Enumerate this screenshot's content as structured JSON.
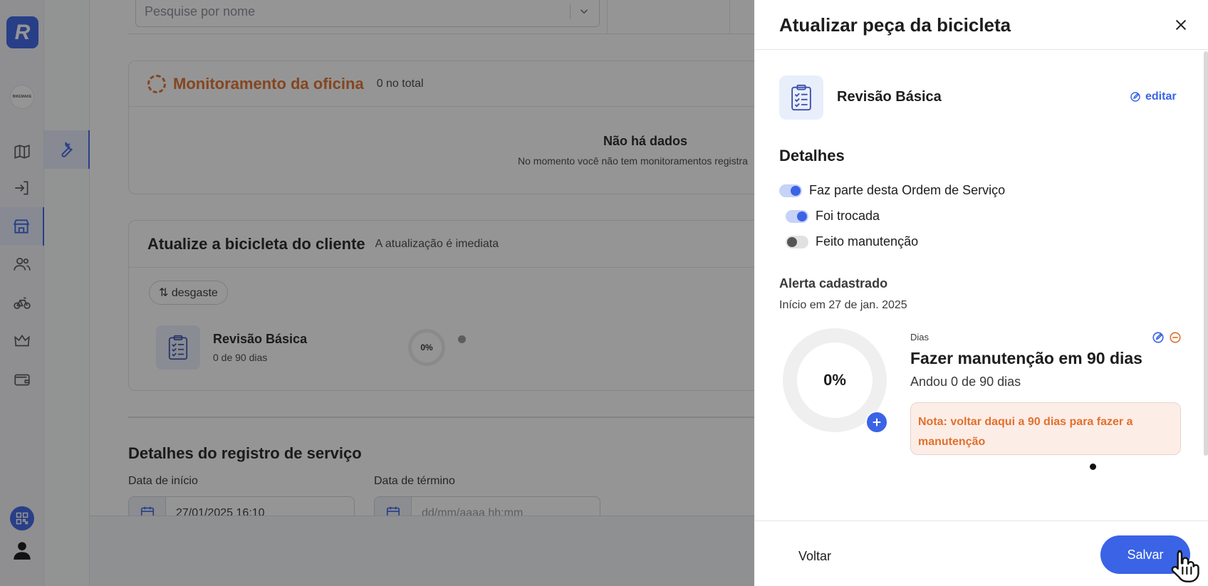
{
  "rail": {
    "logo_letter": "R",
    "brand_text": "BIKEMAKE"
  },
  "main": {
    "search_placeholder": "Pesquise por nome",
    "monitor": {
      "title": "Monitoramento da oficina",
      "count": "0 no total",
      "empty_title": "Não há dados",
      "empty_text": "No momento você não tem monitoramentos registra"
    },
    "bike_update": {
      "title": "Atualize a bicicleta do cliente",
      "subtitle": "A atualização é imediata",
      "sort_chip": "⇅ desgaste",
      "part_name": "Revisão Básica",
      "part_days": "0 de 90 dias",
      "ring_value": "0%"
    },
    "service": {
      "title": "Detalhes do registro de serviço",
      "start_label": "Data de início",
      "end_label": "Data de término",
      "start_value": "27/01/2025 16:10",
      "end_placeholder": "dd/mm/aaaa hh:mm"
    }
  },
  "drawer": {
    "title": "Atualizar peça da bicicleta",
    "part_name": "Revisão Básica",
    "edit_label": "editar",
    "details_title": "Detalhes",
    "toggles": [
      {
        "label": "Faz parte desta Ordem de Serviço",
        "on": true
      },
      {
        "label": "Foi trocada",
        "on": true
      },
      {
        "label": "Feito manutenção",
        "on": false
      }
    ],
    "alert": {
      "title": "Alerta cadastrado",
      "start": "Início em 27 de jan. 2025",
      "progress_value": "0%",
      "progress": 0,
      "kind": "Dias",
      "name": "Fazer manutenção em 90 dias",
      "progress_text": "Andou 0 de 90 dias",
      "note_label": "Nota:",
      "note_text": "voltar daqui a 90 dias para fazer a manutenção"
    },
    "back_label": "Voltar",
    "save_label": "Salvar"
  },
  "colors": {
    "accent": "#3a63e6",
    "warning": "#e1702c",
    "note_bg": "#fdede7"
  },
  "icons": [
    "close-icon",
    "clipboard-icon",
    "edit-icon",
    "remove-icon",
    "plus-icon",
    "map-icon",
    "login-icon",
    "store-icon",
    "users-icon",
    "bike-icon",
    "crown-icon",
    "wallet-icon",
    "wrench-icon",
    "qr-icon",
    "user-icon",
    "calendar-icon",
    "chevron-down-icon",
    "hand-cursor-icon"
  ]
}
